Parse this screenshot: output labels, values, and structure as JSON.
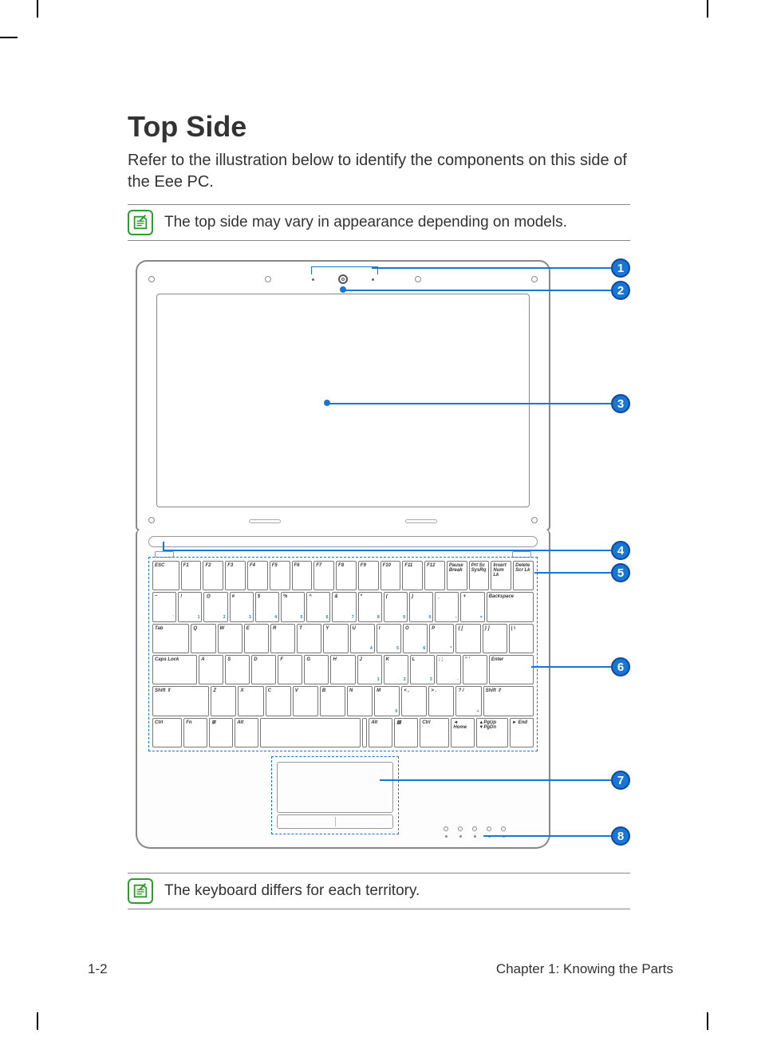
{
  "heading": "Top Side",
  "intro": "Refer to the illustration below to identify the components on this side of the Eee PC.",
  "note_top": "The top side may vary in appearance depending on models.",
  "note_bottom": "The keyboard differs for each territory.",
  "callouts": {
    "c1": "1",
    "c2": "2",
    "c3": "3",
    "c4": "4",
    "c5": "5",
    "c6": "6",
    "c7": "7",
    "c8": "8"
  },
  "keyboard": {
    "row0": [
      "ESC",
      "F1",
      "F2",
      "F3",
      "F4",
      "F5",
      "F6",
      "F7",
      "F8",
      "F9",
      "F10",
      "F11",
      "F12",
      "Pause Break",
      "Prt Sc SysRq",
      "Insert Num Lk",
      "Delete Scr Lk"
    ],
    "row1_top": [
      "~",
      "!",
      "@",
      "#",
      "$",
      "%",
      "^",
      "&",
      "*",
      "(",
      ")",
      "_",
      "+",
      "Backspace"
    ],
    "row1_bot": [
      "`",
      "1",
      "2",
      "3",
      "4",
      "5",
      "6",
      "7",
      "8",
      "9",
      "0",
      "-",
      "=",
      ""
    ],
    "row2": [
      "Tab",
      "Q",
      "W",
      "E",
      "R",
      "T",
      "Y",
      "U",
      "I",
      "O",
      "P",
      "{ [",
      "} ]",
      "| \\"
    ],
    "row2_sub": [
      "",
      "",
      "",
      "",
      "",
      "",
      "",
      "4",
      "5",
      "6",
      "*",
      "",
      "",
      ""
    ],
    "row3": [
      "Caps Lock",
      "A",
      "S",
      "D",
      "F",
      "G",
      "H",
      "J",
      "K",
      "L",
      ": ;",
      "\" '",
      "Enter"
    ],
    "row3_sub": [
      "",
      "",
      "",
      "",
      "",
      "",
      "",
      "1",
      "2",
      "3",
      "-",
      "",
      ""
    ],
    "row4": [
      "Shift ⇧",
      "Z",
      "X",
      "C",
      "V",
      "B",
      "N",
      "M",
      "< ,",
      "> .",
      "? /",
      "Shift ⇧"
    ],
    "row4_sub": [
      "",
      "",
      "",
      "",
      "",
      "",
      "",
      "0",
      "",
      "",
      "+",
      ""
    ],
    "row5": [
      "Ctrl",
      "Fn",
      "⊞",
      "Alt",
      "",
      "",
      "Alt",
      "▤",
      "Ctrl",
      "◄ Home",
      "▲PgUp ▼PgDn",
      "► End"
    ]
  },
  "footer": {
    "page": "1-2",
    "chapter": "Chapter 1: Knowing the Parts"
  }
}
